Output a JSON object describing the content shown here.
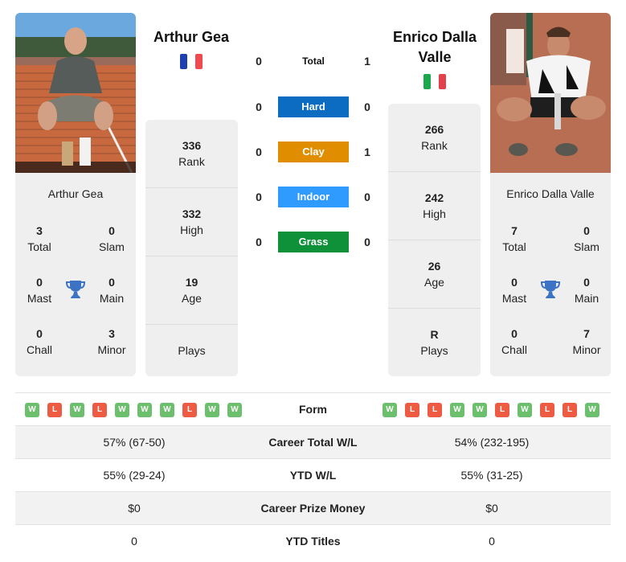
{
  "colors": {
    "hard": "#0b6cc1",
    "clay": "#e08d00",
    "indoor": "#2f9bff",
    "grass": "#0f9139",
    "win": "#6cbf6c",
    "loss": "#ee5b43",
    "trophy": "#3c73c4"
  },
  "player_left": {
    "name": "Arthur Gea",
    "flag": {
      "country": "France",
      "colors": [
        "#1f3fb0",
        "#ffffff",
        "#f04a50"
      ]
    },
    "photo_alt": "Arthur Gea photo",
    "titles": {
      "name": "Arthur Gea",
      "total": {
        "value": "3",
        "label": "Total"
      },
      "slam": {
        "value": "0",
        "label": "Slam"
      },
      "mast": {
        "value": "0",
        "label": "Mast"
      },
      "main": {
        "value": "0",
        "label": "Main"
      },
      "chall": {
        "value": "0",
        "label": "Chall"
      },
      "minor": {
        "value": "3",
        "label": "Minor"
      },
      "icon": "trophy-icon"
    },
    "stats": [
      {
        "value": "336",
        "label": "Rank"
      },
      {
        "value": "332",
        "label": "High"
      },
      {
        "value": "19",
        "label": "Age"
      },
      {
        "value": "",
        "label": "Plays"
      }
    ]
  },
  "player_right": {
    "name": "Enrico Dalla Valle",
    "name_line1": "Enrico Dalla",
    "name_line2": "Valle",
    "flag": {
      "country": "Italy",
      "colors": [
        "#1aa84b",
        "#ffffff",
        "#e2404a"
      ]
    },
    "photo_alt": "Enrico Dalla Valle photo",
    "titles": {
      "name": "Enrico Dalla Valle",
      "total": {
        "value": "7",
        "label": "Total"
      },
      "slam": {
        "value": "0",
        "label": "Slam"
      },
      "mast": {
        "value": "0",
        "label": "Mast"
      },
      "main": {
        "value": "0",
        "label": "Main"
      },
      "chall": {
        "value": "0",
        "label": "Chall"
      },
      "minor": {
        "value": "7",
        "label": "Minor"
      },
      "icon": "trophy-icon"
    },
    "stats": [
      {
        "value": "266",
        "label": "Rank"
      },
      {
        "value": "242",
        "label": "High"
      },
      {
        "value": "26",
        "label": "Age"
      },
      {
        "value": "R",
        "label": "Plays"
      }
    ]
  },
  "h2h": [
    {
      "label": "Total",
      "left": "0",
      "right": "1",
      "surface": "total"
    },
    {
      "label": "Hard",
      "left": "0",
      "right": "0",
      "surface": "hard"
    },
    {
      "label": "Clay",
      "left": "0",
      "right": "1",
      "surface": "clay"
    },
    {
      "label": "Indoor",
      "left": "0",
      "right": "0",
      "surface": "indoor"
    },
    {
      "label": "Grass",
      "left": "0",
      "right": "0",
      "surface": "grass"
    }
  ],
  "comparison": {
    "form": {
      "label": "Form",
      "left": [
        "W",
        "L",
        "W",
        "L",
        "W",
        "W",
        "W",
        "L",
        "W",
        "W"
      ],
      "right": [
        "W",
        "L",
        "L",
        "W",
        "W",
        "L",
        "W",
        "L",
        "L",
        "W"
      ]
    },
    "rows": [
      {
        "label": "Career Total W/L",
        "left": "57% (67-50)",
        "right": "54% (232-195)"
      },
      {
        "label": "YTD W/L",
        "left": "55% (29-24)",
        "right": "55% (31-25)"
      },
      {
        "label": "Career Prize Money",
        "left": "$0",
        "right": "$0"
      },
      {
        "label": "YTD Titles",
        "left": "0",
        "right": "0"
      }
    ]
  }
}
